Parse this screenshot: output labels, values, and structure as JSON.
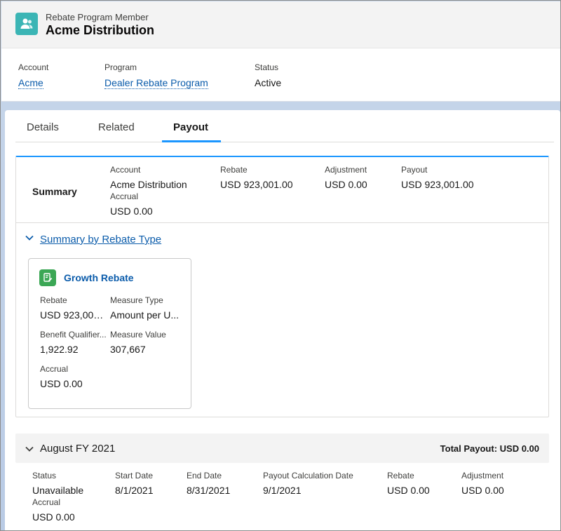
{
  "header": {
    "record_type": "Rebate Program Member",
    "record_name": "Acme Distribution",
    "icon": "user-group-icon",
    "fields": {
      "account": {
        "label": "Account",
        "value": "Acme"
      },
      "program": {
        "label": "Program",
        "value": "Dealer Rebate Program"
      },
      "status": {
        "label": "Status",
        "value": "Active"
      }
    }
  },
  "tabs": {
    "details": "Details",
    "related": "Related",
    "payout": "Payout",
    "active": "payout"
  },
  "summary": {
    "title": "Summary",
    "account": {
      "label": "Account",
      "value": "Acme Distribution"
    },
    "accrual": {
      "label": "Accrual",
      "value": "USD 0.00"
    },
    "rebate": {
      "label": "Rebate",
      "value": "USD 923,001.00"
    },
    "adjustment": {
      "label": "Adjustment",
      "value": "USD 0.00"
    },
    "payout": {
      "label": "Payout",
      "value": "USD 923,001.00"
    }
  },
  "rebate_type_section": {
    "title": "Summary by Rebate Type",
    "card": {
      "icon": "document-edit-icon",
      "title": "Growth Rebate",
      "rebate": {
        "label": "Rebate",
        "value": "USD 923,001...."
      },
      "measure_type": {
        "label": "Measure Type",
        "value": "Amount per U..."
      },
      "benefit_qualifier": {
        "label": "Benefit Qualifier...",
        "value": "1,922.92"
      },
      "measure_value": {
        "label": "Measure Value",
        "value": "307,667"
      },
      "accrual": {
        "label": "Accrual",
        "value": "USD 0.00"
      }
    }
  },
  "period": {
    "title": "August FY 2021",
    "total_payout": "Total Payout: USD 0.00",
    "status": {
      "label": "Status",
      "value": "Unavailable"
    },
    "accrual": {
      "label": "Accrual",
      "value": "USD 0.00"
    },
    "start_date": {
      "label": "Start Date",
      "value": "8/1/2021"
    },
    "end_date": {
      "label": "End Date",
      "value": "8/31/2021"
    },
    "calc_date": {
      "label": "Payout Calculation Date",
      "value": "9/1/2021"
    },
    "rebate": {
      "label": "Rebate",
      "value": "USD 0.00"
    },
    "adjustment": {
      "label": "Adjustment",
      "value": "USD 0.00"
    }
  },
  "colors": {
    "brand_teal": "#3bb5b5",
    "link_blue": "#0b5cab",
    "tab_active": "#1b96ff",
    "rebate_icon_green": "#3ba755"
  }
}
